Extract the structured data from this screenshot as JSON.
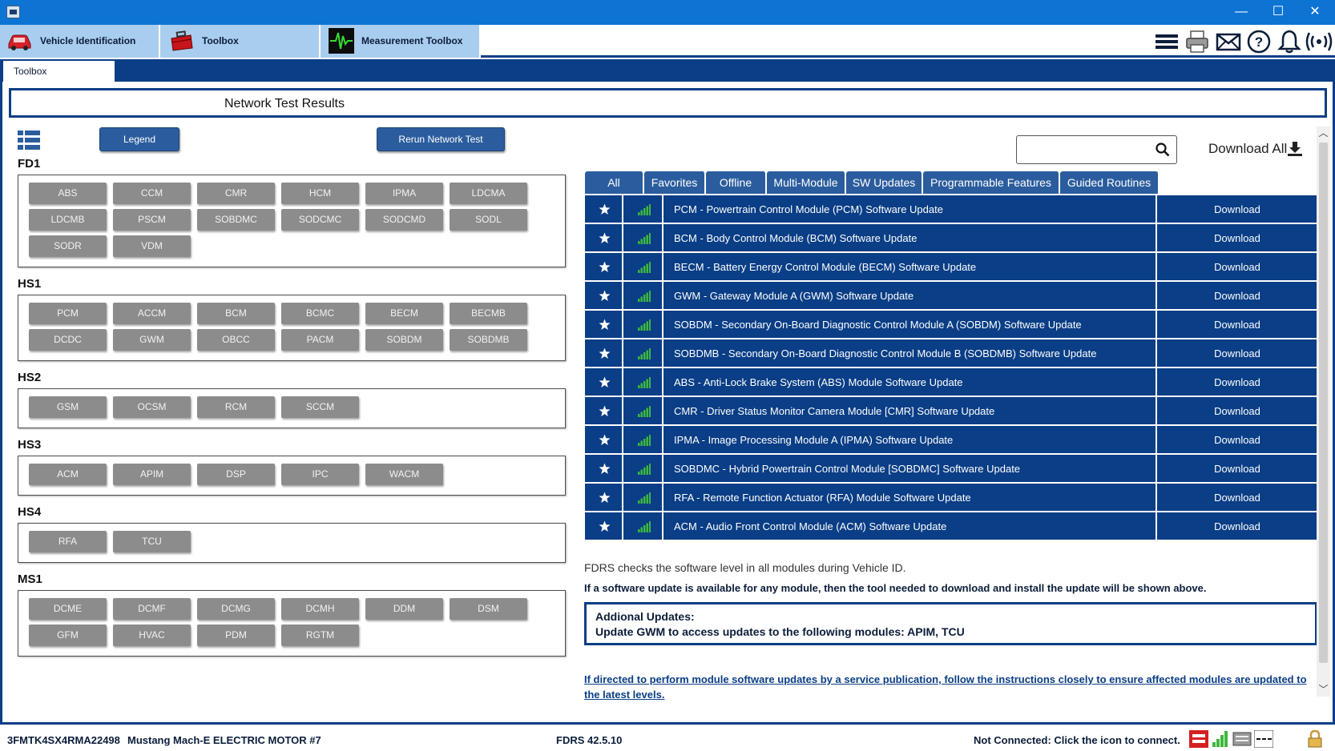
{
  "window": {
    "minimize": "—",
    "maximize": "☐",
    "close": "✕"
  },
  "top_tabs": [
    {
      "label": "Vehicle Identification",
      "icon": "car-icon"
    },
    {
      "label": "Toolbox",
      "icon": "toolbox-icon"
    },
    {
      "label": "Measurement Toolbox",
      "icon": "oscilloscope-icon"
    }
  ],
  "toolbar_icons": [
    "menu-icon",
    "printer-icon",
    "mail-icon",
    "help-icon",
    "bell-icon",
    "wireless-icon"
  ],
  "sub_tab": {
    "label": "Toolbox"
  },
  "page": {
    "title": "Network Test Results"
  },
  "buttons": {
    "legend": "Legend",
    "rerun": "Rerun Network Test"
  },
  "buses": [
    {
      "name": "FD1",
      "modules": [
        "ABS",
        "CCM",
        "CMR",
        "HCM",
        "IPMA",
        "LDCMA",
        "LDCMB",
        "PSCM",
        "SOBDMC",
        "SODCMC",
        "SODCMD",
        "SODL",
        "SODR",
        "VDM"
      ]
    },
    {
      "name": "HS1",
      "modules": [
        "PCM",
        "ACCM",
        "BCM",
        "BCMC",
        "BECM",
        "BECMB",
        "DCDC",
        "GWM",
        "OBCC",
        "PACM",
        "SOBDM",
        "SOBDMB"
      ]
    },
    {
      "name": "HS2",
      "modules": [
        "GSM",
        "OCSM",
        "RCM",
        "SCCM"
      ]
    },
    {
      "name": "HS3",
      "modules": [
        "ACM",
        "APIM",
        "DSP",
        "IPC",
        "WACM"
      ]
    },
    {
      "name": "HS4",
      "modules": [
        "RFA",
        "TCU"
      ]
    },
    {
      "name": "MS1",
      "modules": [
        "DCME",
        "DCMF",
        "DCMG",
        "DCMH",
        "DDM",
        "DSM",
        "GFM",
        "HVAC",
        "PDM",
        "RGTM"
      ]
    }
  ],
  "search": {
    "value": "",
    "placeholder": ""
  },
  "download_all": {
    "label": "Download All"
  },
  "filter_tabs": [
    "All",
    "Favorites",
    "Offline",
    "Multi-Module",
    "SW Updates",
    "Programmable Features",
    "Guided Routines"
  ],
  "updates": [
    {
      "desc": "PCM - Powertrain Control Module (PCM) Software Update",
      "action": "Download"
    },
    {
      "desc": "BCM - Body Control Module (BCM) Software Update",
      "action": "Download"
    },
    {
      "desc": "BECM - Battery Energy Control Module (BECM) Software Update",
      "action": "Download"
    },
    {
      "desc": "GWM - Gateway Module A (GWM) Software Update",
      "action": "Download"
    },
    {
      "desc": "SOBDM - Secondary On-Board Diagnostic Control Module A (SOBDM) Software Update",
      "action": "Download"
    },
    {
      "desc": "SOBDMB - Secondary On-Board Diagnostic Control Module B (SOBDMB) Software Update",
      "action": "Download"
    },
    {
      "desc": "ABS - Anti-Lock Brake System (ABS) Module Software Update",
      "action": "Download"
    },
    {
      "desc": "CMR - Driver Status Monitor Camera Module [CMR] Software Update",
      "action": "Download"
    },
    {
      "desc": "IPMA - Image Processing Module A (IPMA) Software Update",
      "action": "Download"
    },
    {
      "desc": "SOBDMC - Hybrid Powertrain Control Module [SOBDMC] Software Update",
      "action": "Download"
    },
    {
      "desc": "RFA - Remote Function Actuator (RFA) Module Software Update",
      "action": "Download"
    },
    {
      "desc": "ACM - Audio Front Control Module (ACM) Software Update",
      "action": "Download"
    }
  ],
  "info": {
    "line1": "FDRS checks the software level in all modules during Vehicle ID.",
    "line2": "If a software update is available for any module, then the tool needed to download and install the update will be shown above.",
    "addl_title": "Addional Updates:",
    "addl_text": "Update GWM to access updates to the following modules: APIM, TCU",
    "notice": "If directed to perform module software updates by a service publication, follow the instructions closely to ensure affected modules are updated to the latest levels."
  },
  "status": {
    "vin": "3FMTK4SX4RMA22498",
    "vehicle": "Mustang Mach-E ELECTRIC MOTOR #7",
    "version": "FDRS 42.5.10",
    "connection": "Not Connected: Click the icon to connect."
  },
  "colors": {
    "title_bar": "#0e74d3",
    "dark_blue": "#0a3e86",
    "button_blue": "#2b5d9e",
    "module_gray": "#8c8c8c",
    "tab_light": "#a9cdee",
    "signal_green": "#3db83d"
  }
}
